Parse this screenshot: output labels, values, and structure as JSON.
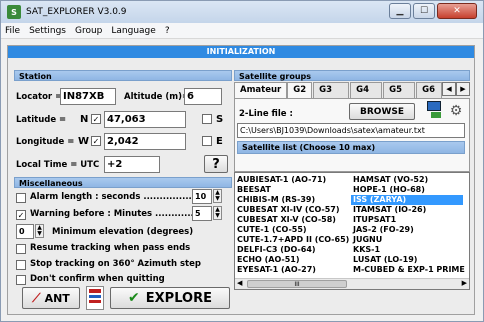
{
  "window": {
    "title": "SAT_EXPLORER V3.0.9"
  },
  "menu": [
    "File",
    "Settings",
    "Group",
    "Language",
    "?"
  ],
  "header": {
    "label": "INITIALIZATION"
  },
  "station": {
    "heading": "Station",
    "locator_label": "Locator =",
    "locator_value": "IN87XB",
    "altitude_label": "Altitude (m)=",
    "altitude_value": "6",
    "latitude_label": "Latitude =",
    "latitude_hemi": "N",
    "latitude_value": "47,063",
    "latitude_alt_hemi": "S",
    "longitude_label": "Longitude =",
    "longitude_hemi": "W",
    "longitude_value": "2,042",
    "longitude_alt_hemi": "E",
    "localtime_label": "Local Time = UTC",
    "localtime_value": "+2",
    "help_label": "?"
  },
  "misc": {
    "heading": "Miscellaneous",
    "alarm_label": "Alarm length : seconds ..................",
    "alarm_value": "10",
    "warning_label": "Warning before : Minutes ...............",
    "warning_value": "5",
    "minelev_value": "0",
    "minelev_label": "Minimum elevation (degrees)",
    "resume_label": "Resume tracking when pass ends",
    "stop_label": "Stop tracking on 360° Azimuth step",
    "confirm_label": "Don't confirm when quitting"
  },
  "buttons": {
    "ant": "ANT",
    "explore": "EXPLORE"
  },
  "satgroups": {
    "heading": "Satellite groups",
    "tabs": [
      "Amateur",
      "G2",
      "G3",
      "G4",
      "G5",
      "G6"
    ],
    "twoline_label": "2-Line file :",
    "browse_label": "BROWSE",
    "path": "C:\\Users\\BJ1039\\Downloads\\satex\\amateur.txt",
    "list_heading": "Satellite list (Choose 10 max)"
  },
  "satlist": {
    "col1": [
      "AUBIESAT-1 (AO-71)",
      "BEESAT",
      "CHIBIS-M (RS-39)",
      "CUBESAT XI-IV (CO-57)",
      "CUBESAT XI-V (CO-58)",
      "CUTE-1 (CO-55)",
      "CUTE-1.7+APD II (CO-65)",
      "DELFI-C3 (DO-64)",
      "ECHO (AO-51)",
      "EYESAT-1 (AO-27)"
    ],
    "col2": [
      "HAMSAT (VO-52)",
      "HOPE-1 (HO-68)",
      "ISS (ZARYA)",
      "ITAMSAT (IO-26)",
      "ITUPSAT1",
      "JAS-2 (FO-29)",
      "JUGNU",
      "KKS-1",
      "LUSAT (LO-19)",
      "M-CUBED & EXP-1 PRIME"
    ],
    "selected": "ISS (ZARYA)",
    "scroll_label": "III"
  },
  "colors": {
    "accent": "#2f8ae2",
    "selected": "#3399ff"
  }
}
